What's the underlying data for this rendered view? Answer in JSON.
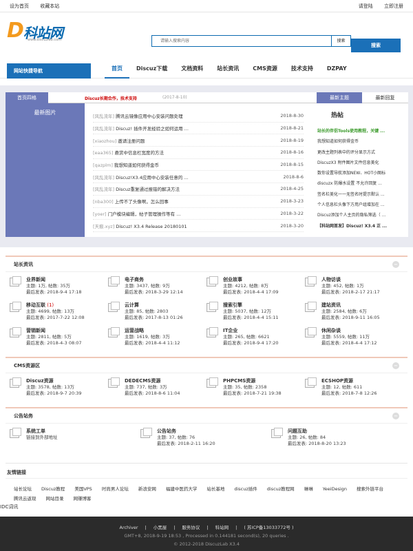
{
  "topbar": {
    "set_home": "设为首页",
    "bookmark": "收藏本站",
    "login": "请登陆",
    "register": "立即注册"
  },
  "logo": {
    "text": "科站网",
    "letter": "D",
    "sub": "www.discuzlab.com"
  },
  "search": {
    "placeholder": "请输入搜索内容",
    "select": "搜索",
    "button": "搜索"
  },
  "nav": {
    "quick": "网站快捷导航",
    "items": [
      "首页",
      "Discuz下载",
      "文档资料",
      "站长资讯",
      "CMS资源",
      "技术支持",
      "DZPAY"
    ]
  },
  "grid": {
    "title": "首页四格",
    "notice": "Discuz长期合作，技术支持",
    "notice_date": "(2017-8-10)",
    "tab_new": "最新主题",
    "tab_reply": "最新回复",
    "pic_title": "最新图片",
    "hot_title": "热帖",
    "news": [
      {
        "cat": "[风乱流年]",
        "title": "腾讯云镜像应用中心安装问题处理",
        "date": "2018-8-30"
      },
      {
        "cat": "[风乱流年]",
        "title": "Discuz! 插件开发经验之如何运用 ...",
        "date": "2018-8-21"
      },
      {
        "cat": "[xiaozhou]",
        "title": "邀请注册问题",
        "date": "2018-8-19"
      },
      {
        "cat": "[eaa365]",
        "title": "悬赏中信息栏宽度的方法",
        "date": "2018-8-16"
      },
      {
        "cat": "[qazplm]",
        "title": "我想知道如何获得金币",
        "date": "2018-8-15"
      },
      {
        "cat": "[风乱流年]",
        "title": "Discuz!X3.4应用中心安装任意的 ...",
        "date": "2018-8-6"
      },
      {
        "cat": "[风乱流年]",
        "title": "Discuz重复通过报错的解决方法",
        "date": "2018-4-25"
      },
      {
        "cat": "[nba300]",
        "title": "上传不了头像啊，怎么回事",
        "date": "2018-3-23"
      },
      {
        "cat": "[yoer]",
        "title": "门户模块编辑，帖子管理操作等有 ...",
        "date": "2018-3-22"
      },
      {
        "cat": "[天痕.xyz]",
        "title": "Discuz! X3.4 Release 20180101",
        "date": "2018-3-20"
      }
    ],
    "hot": [
      {
        "text": "站长的伴侣Tools使用教程，关键 ...",
        "style": "g"
      },
      {
        "text": "我想知道如何获得金币",
        "style": ""
      },
      {
        "text": "更改主题列表中的评分显示方式",
        "style": ""
      },
      {
        "text": "DiscuzX3 附件图片文件信息美化",
        "style": ""
      },
      {
        "text": "数你设置导航添加NEW、HOT小图标",
        "style": ""
      },
      {
        "text": "discuzx 防爆水设置  不允许回复 ...",
        "style": ""
      },
      {
        "text": "签名栏美化一一无签名时提示默认 ...",
        "style": ""
      },
      {
        "text": "个人信息栏头像下方用户组增加在 ...",
        "style": ""
      },
      {
        "text": "Discuz添加个人主页的隐私筛选（ ...",
        "style": ""
      },
      {
        "text": "【科站网首发】Discuz! X3.4 正 ...",
        "style": "b"
      }
    ]
  },
  "sections": [
    {
      "title": "站长资讯",
      "rows": [
        [
          {
            "name": "业界新闻",
            "count": "",
            "stats": "主题: 1万, 帖数: 35万",
            "last": "最后发表: 2018-9-4 17:18"
          },
          {
            "name": "电子商务",
            "count": "",
            "stats": "主题: 3437, 帖数: 9万",
            "last": "最后发表: 2018-3-29 12:14"
          },
          {
            "name": "创业故事",
            "count": "",
            "stats": "主题: 4212, 帖数: 8万",
            "last": "最后发表: 2018-4-4 17:09"
          },
          {
            "name": "人物访谈",
            "count": "",
            "stats": "主题: 452, 帖数: 1万",
            "last": "最后发表: 2018-2-17 21:17"
          }
        ],
        [
          {
            "name": "移动互联",
            "count": "(1)",
            "stats": "主题: 4699, 帖数: 13万",
            "last": "最后发表: 2017-7-22 12:08"
          },
          {
            "name": "云计算",
            "count": "",
            "stats": "主题: 85, 帖数: 2803",
            "last": "最后发表: 2017-8-13 01:26"
          },
          {
            "name": "搜索引擎",
            "count": "",
            "stats": "主题: 5037, 帖数: 12万",
            "last": "最后发表: 2018-4-4 15:11"
          },
          {
            "name": "建站资讯",
            "count": "",
            "stats": "主题: 2584, 帖数: 6万",
            "last": "最后发表: 2018-9-11 16:05"
          }
        ],
        [
          {
            "name": "营销新闻",
            "count": "",
            "stats": "主题: 2811, 帖数: 5万",
            "last": "最后发表: 2018-4-3 08:07"
          },
          {
            "name": "运营战略",
            "count": "",
            "stats": "主题: 1619, 帖数: 3万",
            "last": "最后发表: 2018-4-4 11:12"
          },
          {
            "name": "IT企业",
            "count": "",
            "stats": "主题: 265, 帖数: 6621",
            "last": "最后发表: 2018-9-4 17:20"
          },
          {
            "name": "休闲杂谈",
            "count": "",
            "stats": "主题: 5559, 帖数: 11万",
            "last": "最后发表: 2018-4-4 17:12"
          }
        ]
      ]
    },
    {
      "title": "CMS资源区",
      "rows": [
        [
          {
            "name": "Discuz资源",
            "count": "",
            "stats": "主题: 3578, 帖数: 13万",
            "last": "最后发表: 2018-9-7 20:39"
          },
          {
            "name": "DEDECMS资源",
            "count": "",
            "stats": "主题: 737, 帖数: 3万",
            "last": "最后发表: 2018-8-6 11:04"
          },
          {
            "name": "PHPCMS资源",
            "count": "",
            "stats": "主题: 35, 帖数: 2358",
            "last": "最后发表: 2018-7-21 19:38"
          },
          {
            "name": "ECSHOP资源",
            "count": "",
            "stats": "主题: 12, 帖数: 611",
            "last": "最后发表: 2018-7-8 12:26"
          }
        ]
      ]
    }
  ],
  "public": {
    "title": "公告站务",
    "items": [
      {
        "name": "系统工单",
        "line2": "链接到外部地址",
        "line3": ""
      },
      {
        "name": "公告站务",
        "line2": "主题: 37, 帖数: 76",
        "line3": "最后发表: 2018-2-11 16:20"
      },
      {
        "name": "问题互助",
        "line2": "主题: 26, 帖数: 84",
        "line3": "最后发表: 2018-8-20 13:23"
      }
    ]
  },
  "links": {
    "title": "友情链接",
    "items": [
      "站长论坛",
      "Discuz教程",
      "美国VPS",
      "时尚男人论坛",
      "新浪安网",
      "福建中医药大学",
      "站长基地",
      "discuz插件",
      "discuz教程网",
      "琳琳",
      "YeeiDesign",
      "搜索外链平台",
      "腾讯云返现",
      "网站目录",
      "网赚博客"
    ],
    "vertical": "IDC词讯"
  },
  "footer": {
    "links": [
      "Archiver",
      "小黑屋",
      "服务协议",
      "科站网",
      "( 苏ICP备13033772号 )"
    ],
    "line2": "GMT+8, 2018-9-19 18:53 , Processed in 0.144181 second(s), 20 queries .",
    "line3": "© 2012-2018  DiscuzLab X3.4"
  }
}
